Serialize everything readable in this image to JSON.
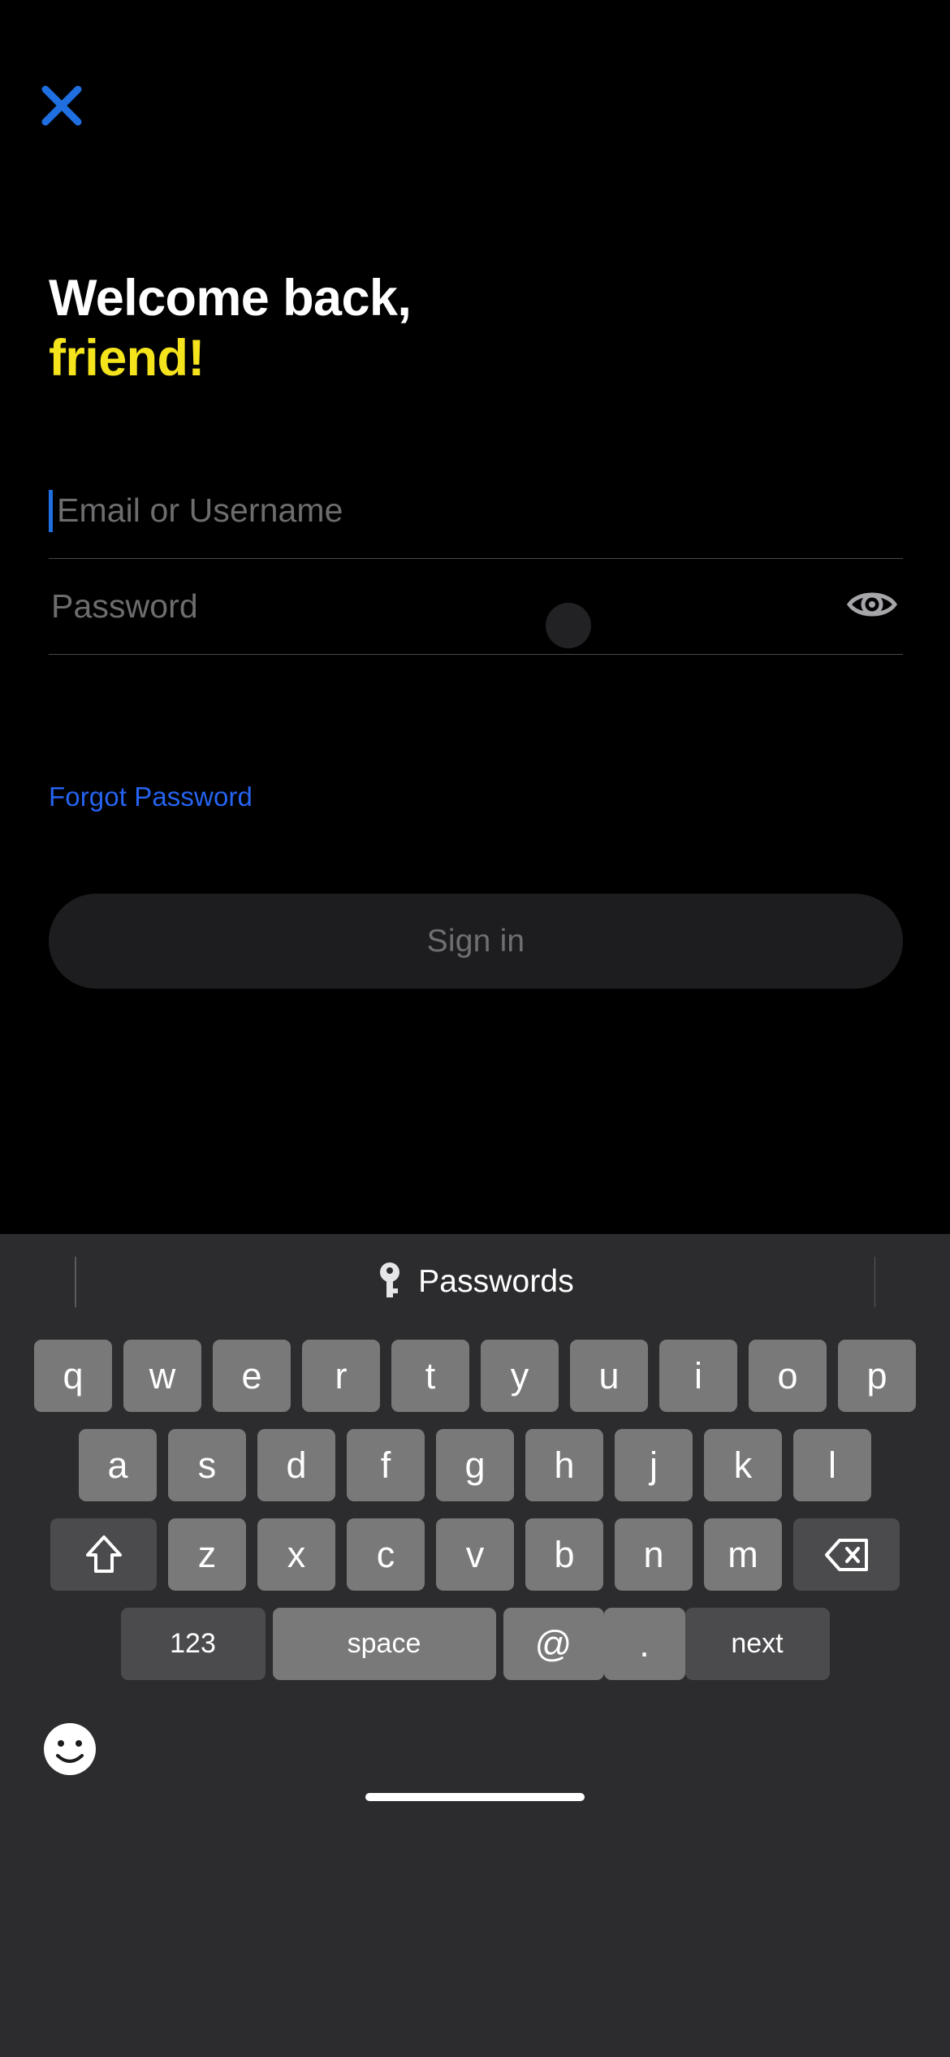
{
  "screen": {
    "background_color": "#000000",
    "accent_blue": "#2563f0",
    "accent_yellow": "#F5E31C"
  },
  "header": {
    "close_icon": "close-x-icon",
    "close_icon_color": "#1f6fe0"
  },
  "headline": {
    "line1": "Welcome back,",
    "line2": "friend!"
  },
  "form": {
    "username": {
      "placeholder": "Email or Username",
      "value": "",
      "focused": true,
      "caret_color": "#1f6fe0"
    },
    "password": {
      "placeholder": "Password",
      "value": "",
      "reveal_icon": "eye-icon",
      "revealed": false
    },
    "forgot_password_label": "Forgot Password",
    "signin_label": "Sign in",
    "signin_enabled": false
  },
  "keyboard": {
    "autofill": {
      "icon": "key-icon",
      "label": "Passwords"
    },
    "row1": [
      "q",
      "w",
      "e",
      "r",
      "t",
      "y",
      "u",
      "i",
      "o",
      "p"
    ],
    "row2": [
      "a",
      "s",
      "d",
      "f",
      "g",
      "h",
      "j",
      "k",
      "l"
    ],
    "row3": [
      "z",
      "x",
      "c",
      "v",
      "b",
      "n",
      "m"
    ],
    "shift_icon": "shift-up-arrow-icon",
    "backspace_icon": "backspace-delete-icon",
    "bottom_row": {
      "numbers_label": "123",
      "space_label": "space",
      "at_label": "@",
      "period_label": ".",
      "return_label": "next"
    },
    "emoji_icon": "smiley-face-icon"
  }
}
